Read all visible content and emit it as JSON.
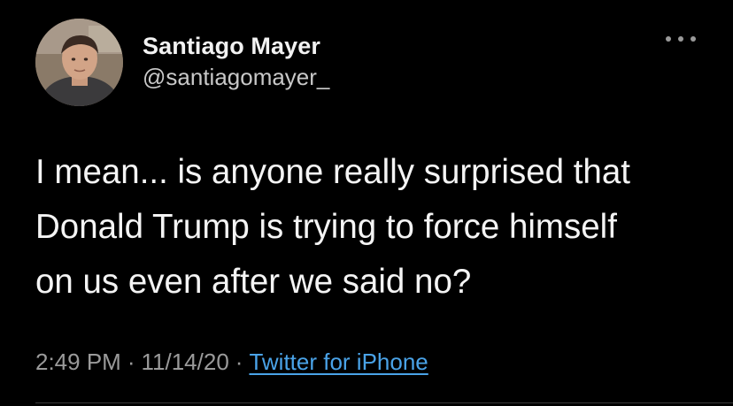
{
  "tweet": {
    "author": {
      "display_name": "Santiago Mayer",
      "handle": "@santiagomayer_",
      "avatar_icon": "profile-photo"
    },
    "more_icon": "more-options-icon",
    "text": "I mean... is anyone really surprised that\nDonald Trump is trying to force himself\non us even after we said no?",
    "time": "2:49 PM",
    "date": "11/14/20",
    "separator": "·",
    "source": "Twitter for iPhone"
  },
  "colors": {
    "background": "#000000",
    "text": "#f4f4f4",
    "secondary": "#9a9a9a",
    "link": "#4aa3e8"
  }
}
